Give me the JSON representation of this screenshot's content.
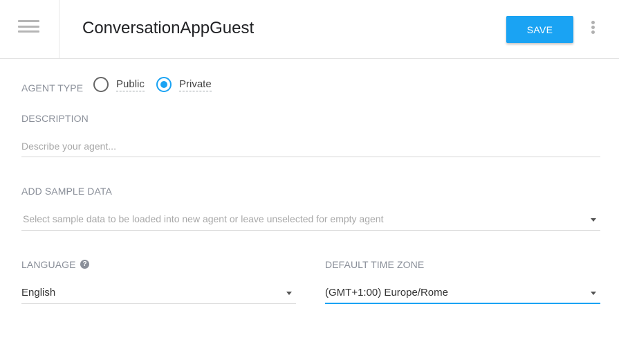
{
  "header": {
    "agent_name": "ConversationAppGuest",
    "save_label": "SAVE"
  },
  "agent_type": {
    "label": "AGENT TYPE",
    "options": [
      {
        "label": "Public",
        "checked": false
      },
      {
        "label": "Private",
        "checked": true
      }
    ]
  },
  "description": {
    "label": "DESCRIPTION",
    "value": "",
    "placeholder": "Describe your agent..."
  },
  "sample_data": {
    "label": "ADD SAMPLE DATA",
    "placeholder": "Select sample data to be loaded into new agent or leave unselected for empty agent"
  },
  "language": {
    "label": "LANGUAGE",
    "value": "English"
  },
  "timezone": {
    "label": "DEFAULT TIME ZONE",
    "value": "(GMT+1:00) Europe/Rome"
  },
  "colors": {
    "accent": "#1aa3f3",
    "label": "#8a8f99"
  },
  "icons": {
    "menu": "hamburger-menu-icon",
    "more": "more-vertical-icon",
    "help": "help-circle-icon",
    "dropdown": "caret-down-icon"
  }
}
